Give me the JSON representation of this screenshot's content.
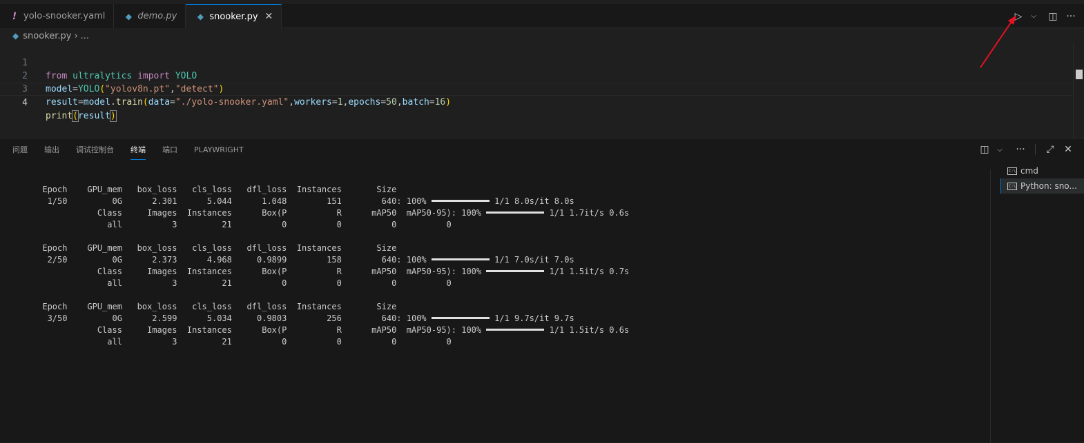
{
  "tabs": [
    {
      "icon": "!",
      "label": "yolo-snooker.yaml",
      "italic": false,
      "active": false
    },
    {
      "icon": "◆",
      "label": "demo.py",
      "italic": true,
      "active": false
    },
    {
      "icon": "◆",
      "label": "snooker.py",
      "italic": false,
      "active": true,
      "close": "✕"
    }
  ],
  "editor_actions": {
    "run": "▷",
    "run_menu": "⌵",
    "split": "◫",
    "more": "···"
  },
  "breadcrumb": {
    "file": "snooker.py",
    "sep": "›",
    "rest": "..."
  },
  "code": {
    "line_numbers": [
      "1",
      "2",
      "3",
      "4"
    ],
    "l1": {
      "kw1": "from",
      "mod": "ultralytics",
      "kw2": "import",
      "cls": "YOLO"
    },
    "l2": {
      "var": "model",
      "eq": "=",
      "cls": "YOLO",
      "p1": "(",
      "s1": "\"yolov8n.pt\"",
      "comma": ",",
      "s2": "\"detect\"",
      "p2": ")"
    },
    "l3": {
      "var": "result",
      "eq": "=",
      "obj": "model",
      "dot": ".",
      "fn": "train",
      "p1": "(",
      "a1": "data",
      "eq1": "=",
      "s1": "\"./yolo-snooker.yaml\"",
      "c1": ",",
      "a2": "workers",
      "eq2": "=",
      "n1": "1",
      "c2": ",",
      "a3": "epochs",
      "eq3": "=",
      "n2": "50",
      "c3": ",",
      "a4": "batch",
      "eq4": "=",
      "n3": "16",
      "p2": ")"
    },
    "l4": {
      "fn": "print",
      "p1": "(",
      "var": "result",
      "p2": ")"
    }
  },
  "panel": {
    "tabs": [
      "问题",
      "输出",
      "调试控制台",
      "终端",
      "端口",
      "PLAYWRIGHT"
    ],
    "active_tab": "终端",
    "actions": {
      "layout": "◫",
      "menu": "⌵",
      "more": "···",
      "maximize": "⤢",
      "close": "✕"
    }
  },
  "terminal": {
    "epochs": [
      {
        "header": "      Epoch    GPU_mem   box_loss   cls_loss   dfl_loss  Instances       Size",
        "train_prefix": "       1/50         0G      2.301      5.044      1.048        151        640: 100% ",
        "train_progress": 1.0,
        "train_suffix": " 1/1 8.0s/it 8.0s",
        "val_prefix": "                 Class     Images  Instances      Box(P          R      mAP50  mAP50-95): 100% ",
        "val_progress": 1.0,
        "val_suffix": " 1/1 1.7it/s 0.6s",
        "val_row": "                   all          3         21          0          0          0          0"
      },
      {
        "header": "      Epoch    GPU_mem   box_loss   cls_loss   dfl_loss  Instances       Size",
        "train_prefix": "       2/50         0G      2.373      4.968     0.9899        158        640: 100% ",
        "train_progress": 1.0,
        "train_suffix": " 1/1 7.0s/it 7.0s",
        "val_prefix": "                 Class     Images  Instances      Box(P          R      mAP50  mAP50-95): 100% ",
        "val_progress": 1.0,
        "val_suffix": " 1/1 1.5it/s 0.7s",
        "val_row": "                   all          3         21          0          0          0          0"
      },
      {
        "header": "      Epoch    GPU_mem   box_loss   cls_loss   dfl_loss  Instances       Size",
        "train_prefix": "       3/50         0G      2.599      5.034     0.9803        256        640: 100% ",
        "train_progress": 1.0,
        "train_suffix": " 1/1 9.7s/it 9.7s",
        "val_prefix": "                 Class     Images  Instances      Box(P          R      mAP50  mAP50-95): 100% ",
        "val_progress": 1.0,
        "val_suffix": " 1/1 1.5it/s 0.6s",
        "val_row": "                   all          3         21          0          0          0          0"
      }
    ],
    "sessions": [
      {
        "icon": "C:\\",
        "label": "cmd",
        "selected": false
      },
      {
        "icon": "C:\\",
        "label": "Python: sno...",
        "selected": true
      }
    ]
  },
  "colors": {
    "accent": "#0078d4",
    "annotation_arrow": "#e81123"
  }
}
